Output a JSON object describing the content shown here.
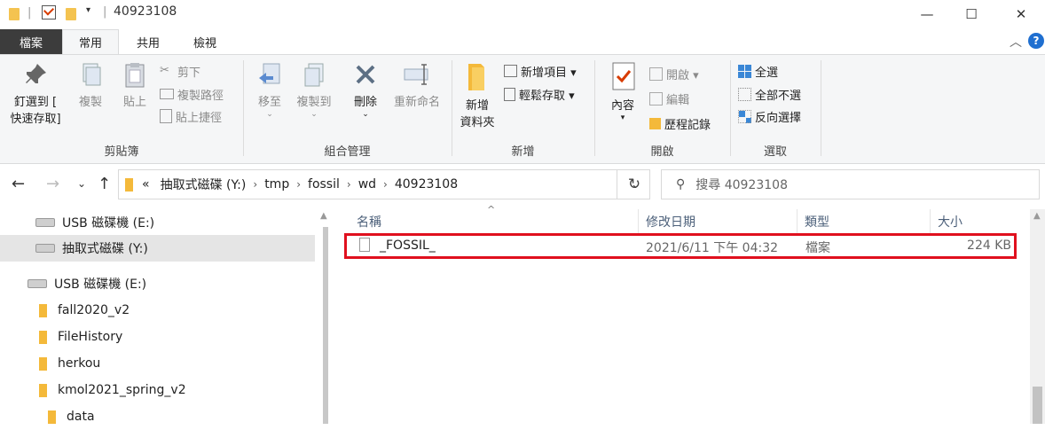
{
  "window": {
    "title": "40923108",
    "controls": {
      "minimize": "—",
      "maximize": "☐",
      "close": "✕"
    }
  },
  "ribbon_tabs": [
    "檔案",
    "常用",
    "共用",
    "檢視"
  ],
  "ribbon": {
    "clipboard": {
      "pin_label_1": "釘選到 [",
      "pin_label_2": "快速存取]",
      "copy": "複製",
      "paste": "貼上",
      "cut": "剪下",
      "copy_path": "複製路徑",
      "paste_shortcut": "貼上捷徑",
      "group": "剪貼簿"
    },
    "organize": {
      "move_to": "移至",
      "copy_to": "複製到",
      "delete": "刪除",
      "rename": "重新命名",
      "group": "組合管理"
    },
    "new": {
      "new_folder_1": "新增",
      "new_folder_2": "資料夾",
      "new_item": "新增項目 ▾",
      "easy_access": "輕鬆存取 ▾",
      "group": "新增"
    },
    "open": {
      "properties": "內容",
      "open": "開啟 ▾",
      "edit": "編輯",
      "history": "歷程記錄",
      "group": "開啟"
    },
    "select": {
      "select_all": "全選",
      "select_none": "全部不選",
      "invert": "反向選擇",
      "group": "選取"
    }
  },
  "address": {
    "prefix": "«",
    "crumbs": [
      "抽取式磁碟 (Y:)",
      "tmp",
      "fossil",
      "wd",
      "40923108"
    ],
    "search_placeholder": "搜尋 40923108"
  },
  "nav": [
    {
      "label": "USB 磁碟機 (E:)",
      "type": "drive"
    },
    {
      "label": "抽取式磁碟 (Y:)",
      "type": "drive"
    },
    {
      "label": "USB 磁碟機 (E:)",
      "type": "drive"
    },
    {
      "label": "fall2020_v2",
      "type": "folder"
    },
    {
      "label": "FileHistory",
      "type": "folder"
    },
    {
      "label": "herkou",
      "type": "folder"
    },
    {
      "label": "kmol2021_spring_v2",
      "type": "folder"
    },
    {
      "label": "data",
      "type": "folder"
    }
  ],
  "columns": [
    "名稱",
    "修改日期",
    "類型",
    "大小"
  ],
  "files": [
    {
      "name": "_FOSSIL_",
      "modified": "2021/6/11 下午 04:32",
      "type": "檔案",
      "size": "224 KB"
    }
  ],
  "colors": {
    "highlight": "#e0101e",
    "file_tab": "#3c3c3c",
    "selected_nav": "#e5e5e5"
  }
}
